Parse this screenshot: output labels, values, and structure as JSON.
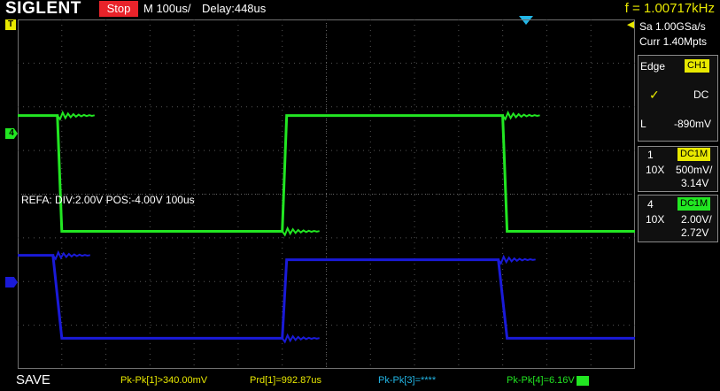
{
  "header": {
    "brand": "SIGLENT",
    "run_state": "Stop",
    "timebase": "M 100us/",
    "delay": "Delay:448us",
    "frequency": "f = 1.00717kHz"
  },
  "markers": {
    "trigger": "T",
    "channel4": "4"
  },
  "reference": {
    "label": "REFA: DIV:2.00V POS:-4.00V 100us"
  },
  "acquisition": {
    "sample_rate": "Sa 1.00GSa/s",
    "memory": "Curr 1.40Mpts"
  },
  "trigger": {
    "type": "Edge",
    "source": "CH1",
    "coupling": "DC",
    "level_label": "L",
    "level": "-890mV"
  },
  "channels": [
    {
      "id": "1",
      "coupling": "DC1M",
      "probe": "10X",
      "scale": "500mV/",
      "offset": "3.14V",
      "color": "#1a1ad8"
    },
    {
      "id": "4",
      "coupling": "DC1M",
      "probe": "10X",
      "scale": "2.00V/",
      "offset": "2.72V",
      "color": "#22e622"
    }
  ],
  "footer": {
    "save": "SAVE",
    "measurements": [
      "Pk-Pk[1]>340.00mV",
      "Prd[1]=992.87us",
      "Pk-Pk[3]=****",
      "Pk-Pk[4]=6.16V"
    ]
  },
  "colors": {
    "trigger_yellow": "#e8e800",
    "ch4_green": "#22e622",
    "ch1_blue": "#1a1ad8",
    "cursor_cyan": "#22b6e6",
    "stop_red": "#e8232a"
  },
  "chart_data": {
    "type": "line",
    "grid": true,
    "x_divisions": 14,
    "y_divisions": 8,
    "series": [
      {
        "color": "#22e622",
        "x": [
          0,
          0.9,
          1.0,
          6.0,
          6.1,
          11.0,
          11.1,
          14
        ],
        "y": [
          5.8,
          5.8,
          3.15,
          3.15,
          5.8,
          5.8,
          3.15,
          3.15
        ]
      },
      {
        "color": "#1a1ad8",
        "x": [
          0,
          0.8,
          1.0,
          6.0,
          6.1,
          10.9,
          11.1,
          14
        ],
        "y": [
          2.6,
          2.6,
          0.7,
          0.7,
          2.5,
          2.5,
          0.7,
          0.7
        ]
      }
    ]
  }
}
